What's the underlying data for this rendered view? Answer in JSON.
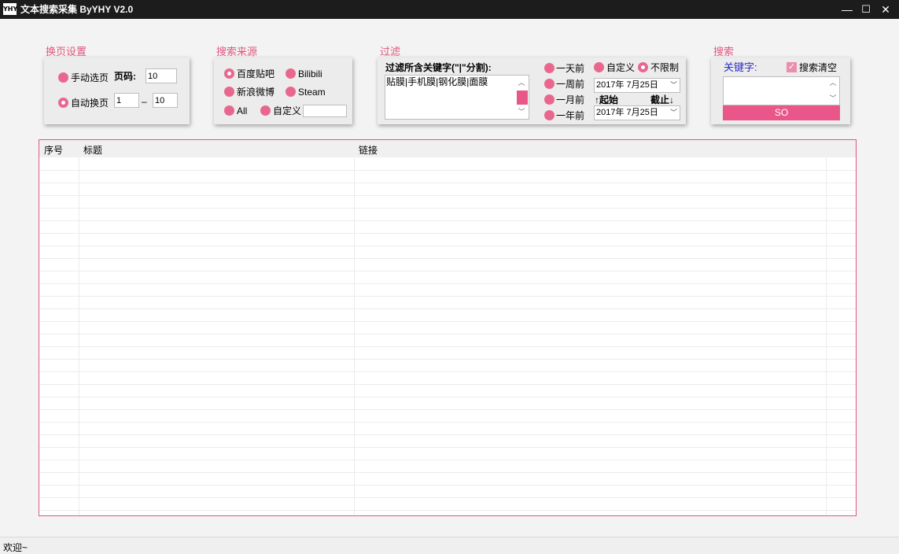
{
  "window": {
    "logo_text": "YHY",
    "title": "文本搜索采集 ByYHY V2.0",
    "btn_min": "—",
    "btn_max": "☐",
    "btn_close": "✕"
  },
  "paging": {
    "group_label": "换页设置",
    "manual_label": "手动选页",
    "page_label": "页码:",
    "page_value": "10",
    "auto_label": "自动换页",
    "from_value": "1",
    "range_sep": "–",
    "to_value": "10",
    "selected": "auto"
  },
  "source": {
    "group_label": "搜索来源",
    "options": [
      "百度贴吧",
      "Bilibili",
      "新浪微博",
      "Steam",
      "All",
      "自定义"
    ],
    "selected": "百度贴吧",
    "custom_value": ""
  },
  "filter": {
    "group_label": "过滤",
    "keywords_label": "过滤所含关键字(\"|\"分割):",
    "keywords_value": "贴膜|手机膜|钢化膜|面膜",
    "time_options": [
      "一天前",
      "一周前",
      "一月前",
      "一年前"
    ],
    "custom_label": "自定义",
    "unlimited_label": "不限制",
    "selected": "不限制",
    "start_date": "2017年  7月25日",
    "end_date": "2017年  7月25日",
    "start_label": "↑起始",
    "end_label": "截止↓"
  },
  "search": {
    "group_label": "搜索",
    "keyword_label": "关键字:",
    "clear_label": "搜索清空",
    "clear_checked": true,
    "keyword_value": "",
    "button_label": "SO"
  },
  "results": {
    "columns": [
      "序号",
      "标题",
      "链接"
    ],
    "rows": []
  },
  "status": {
    "text": "欢迎~"
  },
  "colors": {
    "accent": "#e9578a",
    "label": "#e2567f",
    "keyword_label": "#2b2bcc"
  }
}
